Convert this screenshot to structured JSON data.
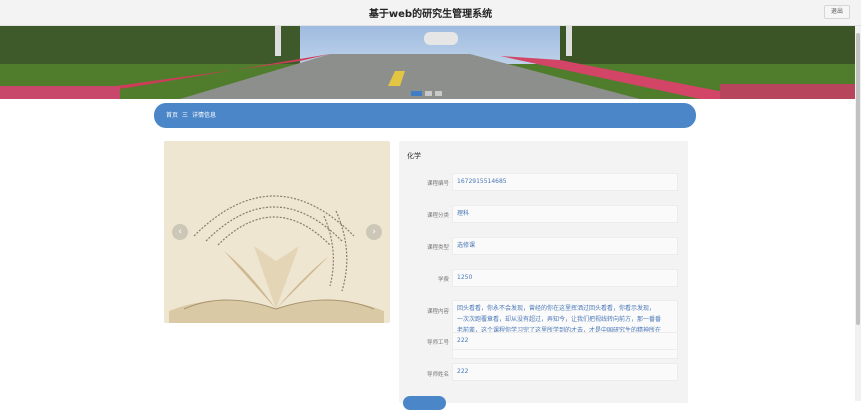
{
  "header": {
    "title": "基于web的研究生管理系统",
    "logout_label": "退出"
  },
  "banner": {
    "slide_count": 3,
    "active_slide": 1
  },
  "breadcrumb": {
    "home": "首页",
    "separator": "三",
    "current": "详情信息"
  },
  "gallery": {
    "prev_icon": "‹",
    "next_icon": "›"
  },
  "course": {
    "title": "化学",
    "fields": [
      {
        "label": "课程编号",
        "value": "1672915514685"
      },
      {
        "label": "课程分类",
        "value": "理科"
      },
      {
        "label": "课程类型",
        "value": "选修课"
      },
      {
        "label": "学费",
        "value": "1250"
      },
      {
        "label": "课程内容",
        "lines": [
          "回头看看，你永不会发现，曾经的你在这里挥洒过回头看看，你看示发现，",
          "一次次跑覆章看，却从没有超过，弄知今，让我们把视线转向前方，那一番番",
          "老前辈，这个课程你学习完了这里所学到的才去，才是中国研究生的精神所在"
        ]
      },
      {
        "label": "导师工号",
        "value": "222"
      },
      {
        "label": "导师姓名",
        "value": "222"
      }
    ]
  },
  "colors": {
    "accent": "#4a86c8",
    "panel": "#f3f3f3",
    "value_text": "#4a78b8"
  }
}
